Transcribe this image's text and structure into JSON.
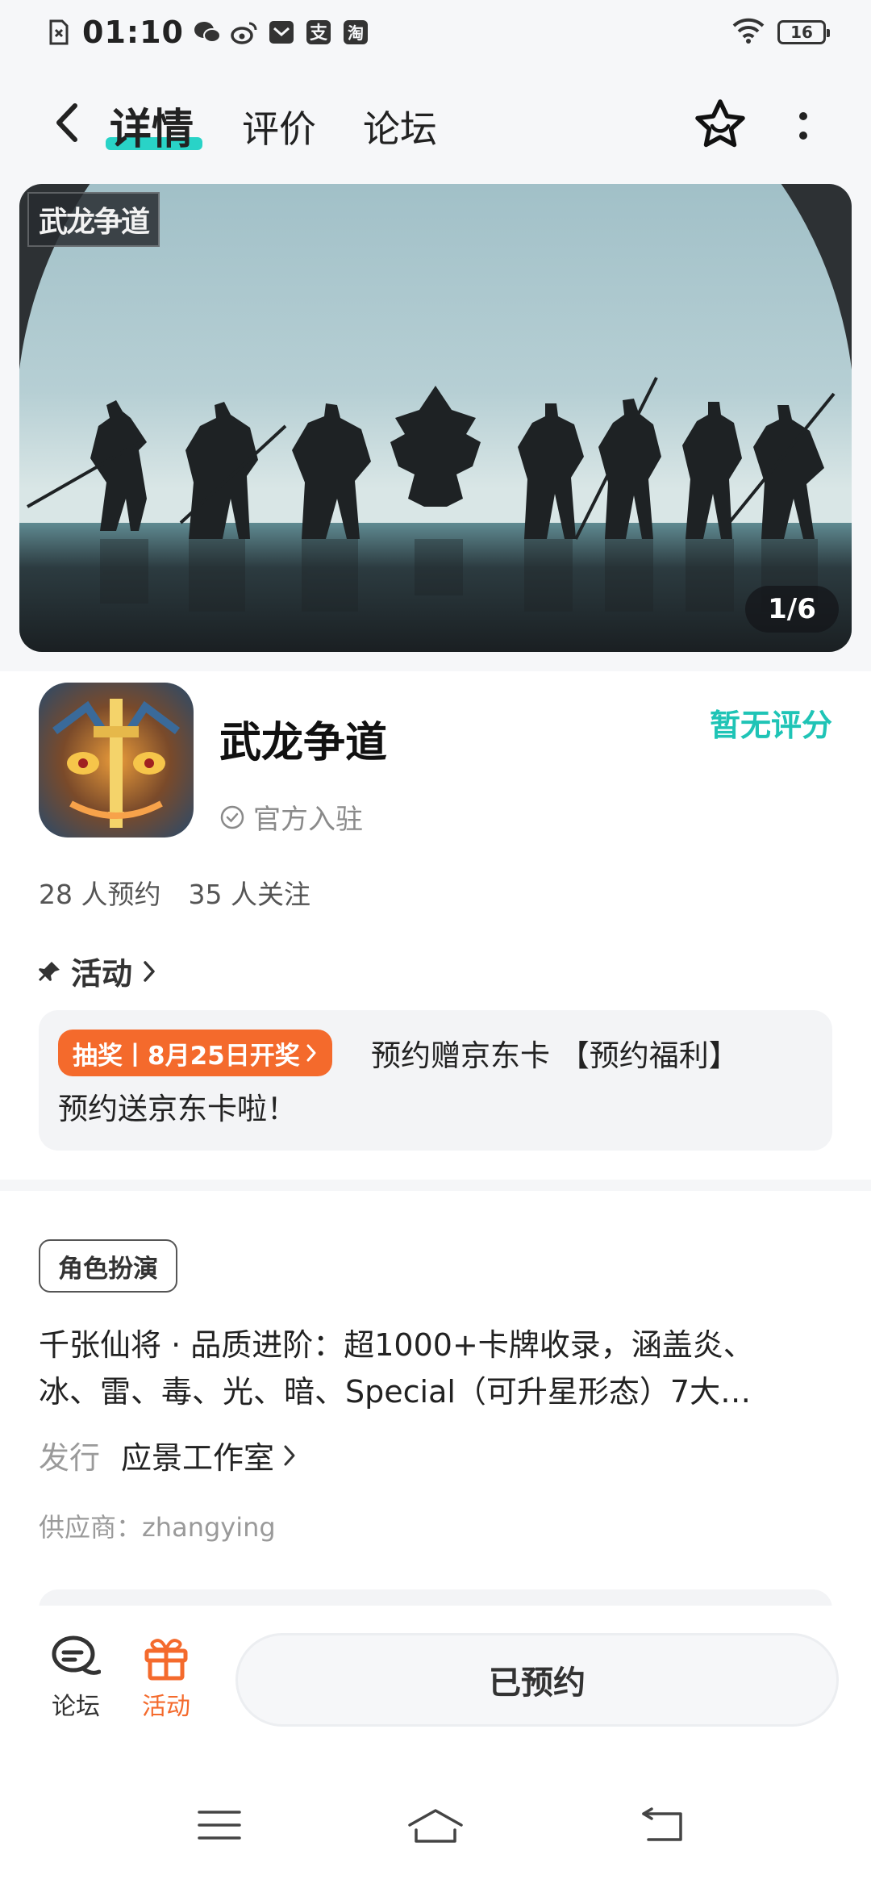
{
  "status_bar": {
    "time": "01:10",
    "notif_icons": [
      "sim-off-icon",
      "wechat-icon",
      "weibo-icon",
      "mail-icon",
      "alipay-icon",
      "taobao-icon"
    ],
    "alipay_char": "支",
    "taobao_char": "淘",
    "battery": "16"
  },
  "nav": {
    "tabs": [
      {
        "label": "详情",
        "active": true
      },
      {
        "label": "评价",
        "active": false
      },
      {
        "label": "论坛",
        "active": false
      }
    ],
    "accent": "#29d3c7"
  },
  "banner": {
    "logo": "武龙争道",
    "counter": "1/6"
  },
  "game": {
    "name": "武龙争道",
    "official_label": "官方入驻",
    "rating_text": "暂无评分",
    "reservations": "28 人预约",
    "followers": "35 人关注"
  },
  "activity": {
    "heading": "活动",
    "tag": "抽奖丨8月25日开奖",
    "title": "预约赠京东卡 【预约福利】",
    "subtitle": "预约送京东卡啦！",
    "tag_color": "#f46a2c"
  },
  "details": {
    "genre": "角色扮演",
    "description": "千张仙将 · 品质进阶：超1000+卡牌收录，涵盖炎、冰、雷、毒、光、暗、Special（可升星形态）7大…",
    "publisher_label": "发行",
    "publisher": "应景工作室",
    "supplier": "供应商：zhangying"
  },
  "bottom_bar": {
    "forum_label": "论坛",
    "activity_label": "活动",
    "reserve_button": "已预约"
  }
}
